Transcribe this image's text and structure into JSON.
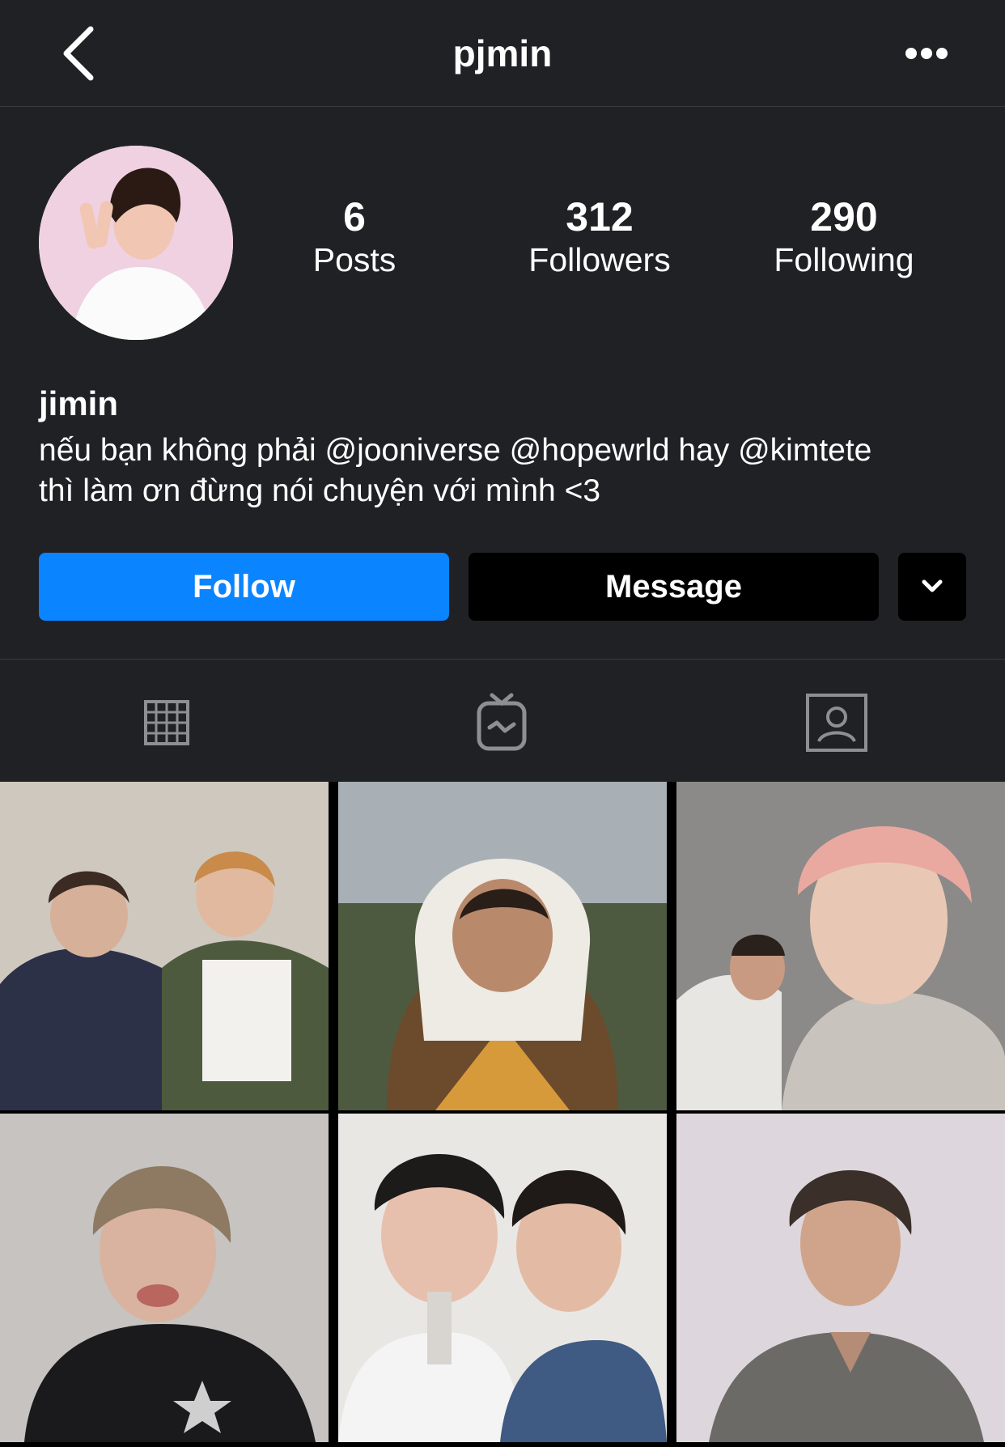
{
  "header": {
    "username": "pjmin",
    "back_icon": "chevron-left-icon",
    "more_icon": "ellipsis-icon"
  },
  "profile": {
    "display_name": "jimin",
    "bio_line1": "nếu bạn không phải @jooniverse @hopewrld hay @kimtete",
    "bio_line2": "thì làm ơn đừng nói chuyện với mình <3",
    "stats": [
      {
        "value": "6",
        "label": "Posts"
      },
      {
        "value": "312",
        "label": "Followers"
      },
      {
        "value": "290",
        "label": "Following"
      }
    ]
  },
  "actions": {
    "follow_label": "Follow",
    "message_label": "Message",
    "dropdown_icon": "chevron-down-icon"
  },
  "tabs": [
    {
      "name": "grid",
      "icon": "grid-icon"
    },
    {
      "name": "igtv",
      "icon": "igtv-icon"
    },
    {
      "name": "tagged",
      "icon": "tagged-user-icon"
    }
  ],
  "colors": {
    "background": "#202124",
    "follow_button": "#0a84ff",
    "message_button": "#000000",
    "divider": "#3a3b3e"
  },
  "posts_count_visible": 6
}
